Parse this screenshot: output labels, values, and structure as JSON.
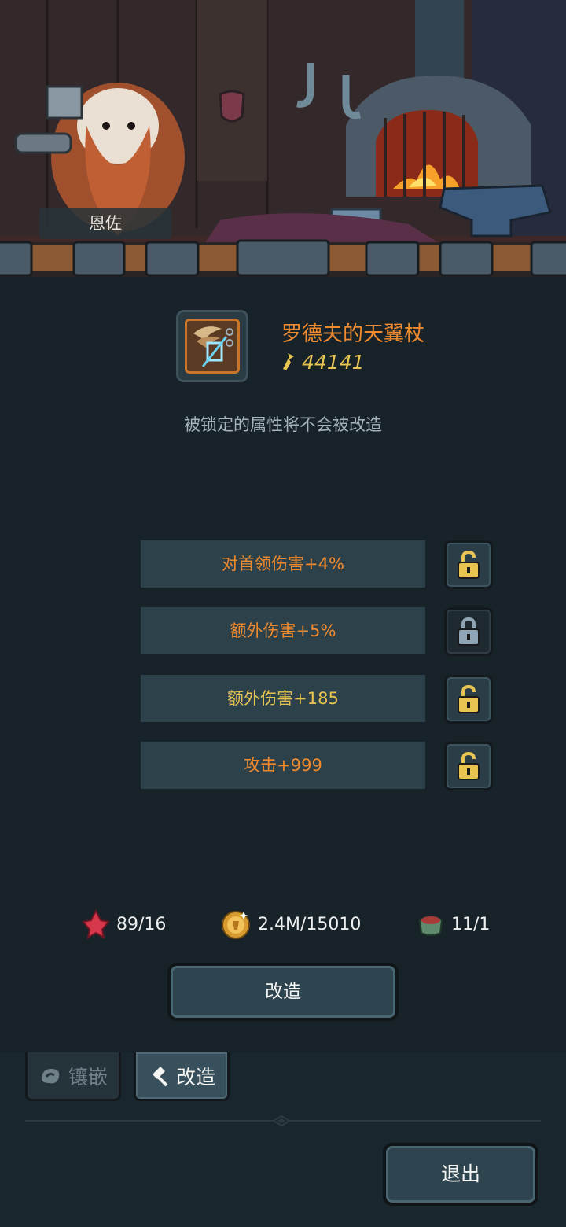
{
  "npc": {
    "name": "恩佐"
  },
  "item": {
    "name": "罗德夫的天翼杖",
    "power": "44141",
    "icon": "winged-staff-icon"
  },
  "hint": "被锁定的属性将不会被改造",
  "attributes": [
    {
      "text": "对首领伤害+4%",
      "color": "#f08a2e",
      "locked": false
    },
    {
      "text": "额外伤害+5%",
      "color": "#f08a2e",
      "locked": true
    },
    {
      "text": "额外伤害+185",
      "color": "#e8c451",
      "locked": false
    },
    {
      "text": "攻击+999",
      "color": "#f08a2e",
      "locked": false
    }
  ],
  "resources": [
    {
      "icon": "red-crystal-icon",
      "value": "89/16"
    },
    {
      "icon": "gold-coin-icon",
      "value": "2.4M/15010"
    },
    {
      "icon": "reforge-stone-icon",
      "value": "11/1"
    }
  ],
  "actions": {
    "reforge_button": "改造"
  },
  "tabs": [
    {
      "icon": "gem-icon",
      "label": "镶嵌",
      "active": false
    },
    {
      "icon": "hammer-icon",
      "label": "改造",
      "active": true
    }
  ],
  "exit_button": "退出"
}
